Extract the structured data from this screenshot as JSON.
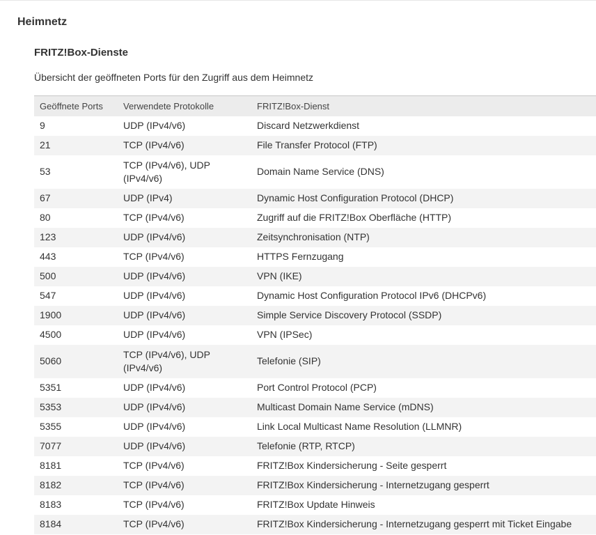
{
  "section": {
    "title": "Heimnetz"
  },
  "subsection": {
    "title": "FRITZ!Box-Dienste",
    "description": "Übersicht der geöffneten Ports für den Zugriff aus dem Heimnetz"
  },
  "table": {
    "headers": [
      "Geöffnete Ports",
      "Verwendete Protokolle",
      "FRITZ!Box-Dienst"
    ],
    "rows": [
      {
        "port": "9",
        "protocol": "UDP (IPv4/v6)",
        "service": "Discard Netzwerkdienst"
      },
      {
        "port": "21",
        "protocol": "TCP (IPv4/v6)",
        "service": "File Transfer Protocol (FTP)"
      },
      {
        "port": "53",
        "protocol": "TCP (IPv4/v6), UDP (IPv4/v6)",
        "service": "Domain Name Service (DNS)"
      },
      {
        "port": "67",
        "protocol": "UDP (IPv4)",
        "service": "Dynamic Host Configuration Protocol (DHCP)"
      },
      {
        "port": "80",
        "protocol": "TCP (IPv4/v6)",
        "service": "Zugriff auf die FRITZ!Box Oberfläche (HTTP)"
      },
      {
        "port": "123",
        "protocol": "UDP (IPv4/v6)",
        "service": "Zeitsynchronisation (NTP)"
      },
      {
        "port": "443",
        "protocol": "TCP (IPv4/v6)",
        "service": "HTTPS Fernzugang"
      },
      {
        "port": "500",
        "protocol": "UDP (IPv4/v6)",
        "service": "VPN (IKE)"
      },
      {
        "port": "547",
        "protocol": "UDP (IPv4/v6)",
        "service": "Dynamic Host Configuration Protocol IPv6 (DHCPv6)"
      },
      {
        "port": "1900",
        "protocol": "UDP (IPv4/v6)",
        "service": "Simple Service Discovery Protocol (SSDP)"
      },
      {
        "port": "4500",
        "protocol": "UDP (IPv4/v6)",
        "service": "VPN (IPSec)"
      },
      {
        "port": "5060",
        "protocol": "TCP (IPv4/v6), UDP (IPv4/v6)",
        "service": "Telefonie (SIP)"
      },
      {
        "port": "5351",
        "protocol": "UDP (IPv4/v6)",
        "service": "Port Control Protocol (PCP)"
      },
      {
        "port": "5353",
        "protocol": "UDP (IPv4/v6)",
        "service": "Multicast Domain Name Service (mDNS)"
      },
      {
        "port": "5355",
        "protocol": "UDP (IPv4/v6)",
        "service": "Link Local Multicast Name Resolution (LLMNR)"
      },
      {
        "port": "7077",
        "protocol": "UDP (IPv4/v6)",
        "service": "Telefonie (RTP, RTCP)"
      },
      {
        "port": "8181",
        "protocol": "TCP (IPv4/v6)",
        "service": "FRITZ!Box Kindersicherung - Seite gesperrt"
      },
      {
        "port": "8182",
        "protocol": "TCP (IPv4/v6)",
        "service": "FRITZ!Box Kindersicherung - Internetzugang gesperrt"
      },
      {
        "port": "8183",
        "protocol": "TCP (IPv4/v6)",
        "service": "FRITZ!Box Update Hinweis"
      },
      {
        "port": "8184",
        "protocol": "TCP (IPv4/v6)",
        "service": "FRITZ!Box Kindersicherung - Internetzugang gesperrt mit Ticket Eingabe"
      }
    ]
  }
}
